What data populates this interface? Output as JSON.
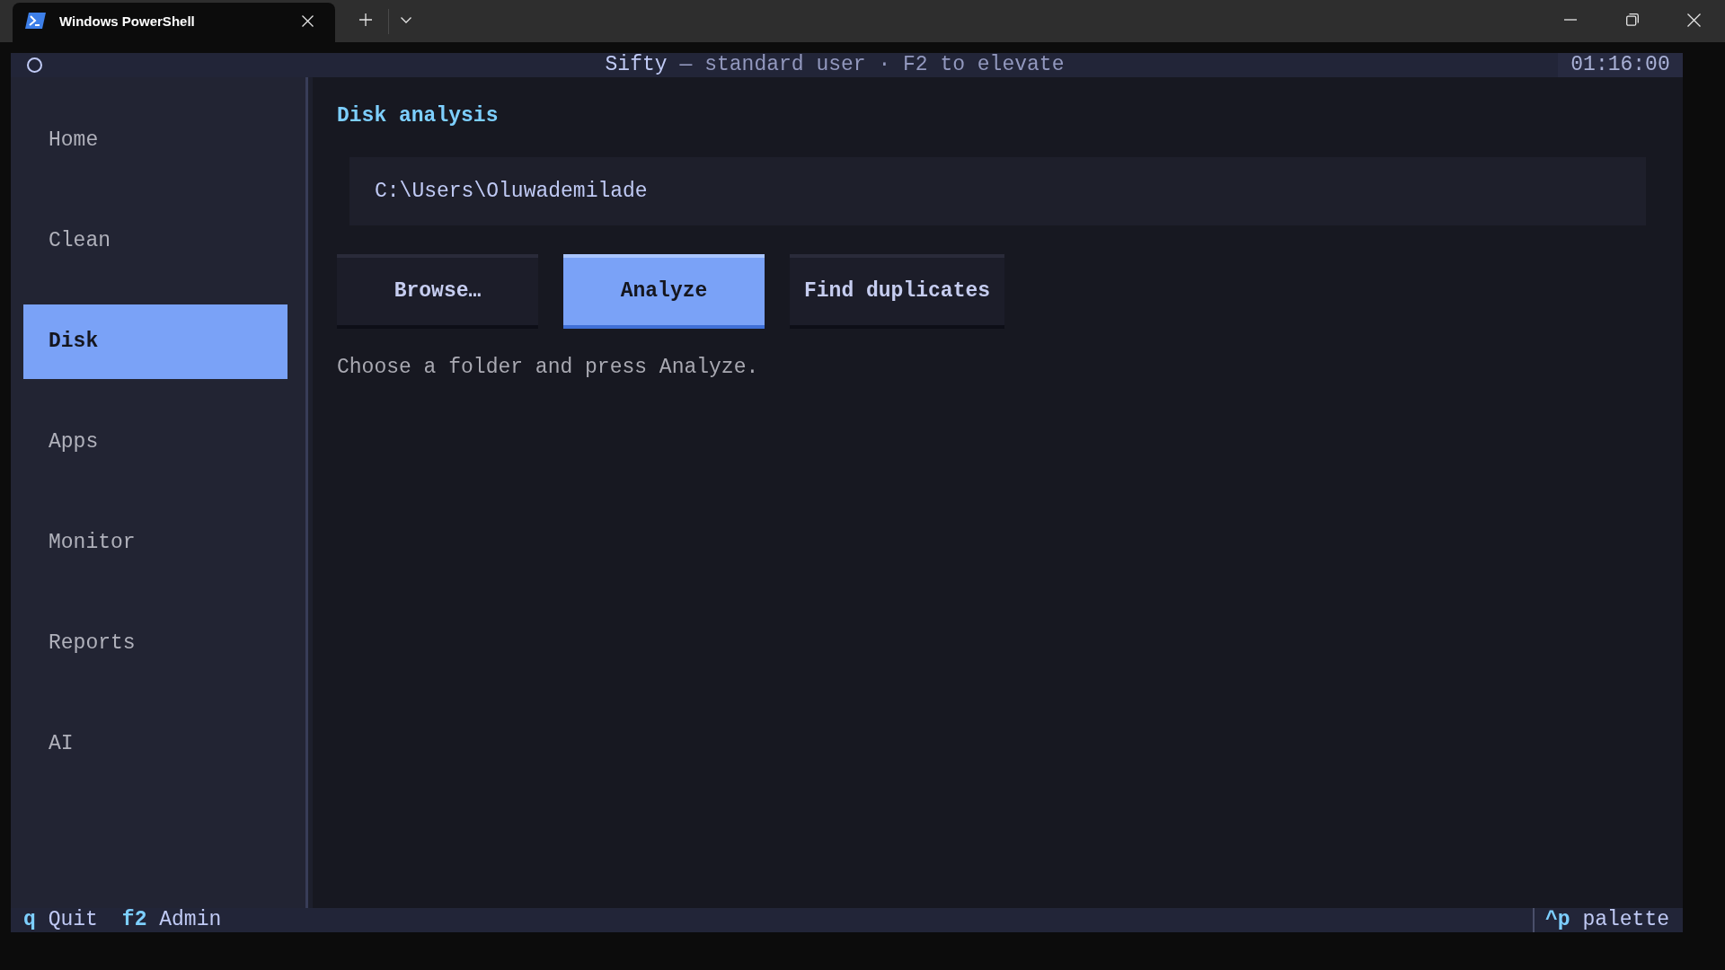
{
  "window": {
    "tab_title": "Windows PowerShell"
  },
  "header": {
    "title": "Sifty",
    "subtitle": "— standard user · F2 to elevate",
    "clock": "01:16:00"
  },
  "sidebar": {
    "items": [
      {
        "label": "Home",
        "selected": false
      },
      {
        "label": "Clean",
        "selected": false
      },
      {
        "label": "Disk",
        "selected": true
      },
      {
        "label": "Apps",
        "selected": false
      },
      {
        "label": "Monitor",
        "selected": false
      },
      {
        "label": "Reports",
        "selected": false
      },
      {
        "label": "AI",
        "selected": false
      }
    ]
  },
  "main": {
    "heading": "Disk analysis",
    "path_field": {
      "value": "C:\\Users\\Oluwademilade"
    },
    "buttons": [
      {
        "label": "Browse…",
        "primary": false
      },
      {
        "label": "Analyze",
        "primary": true
      },
      {
        "label": "Find duplicates",
        "primary": false
      }
    ],
    "hint": "Choose a folder and press Analyze."
  },
  "footer": {
    "bindings": [
      {
        "key": "q",
        "label": "Quit"
      },
      {
        "key": "f2",
        "label": "Admin"
      }
    ],
    "palette": {
      "key": "^p",
      "label": "palette"
    }
  }
}
